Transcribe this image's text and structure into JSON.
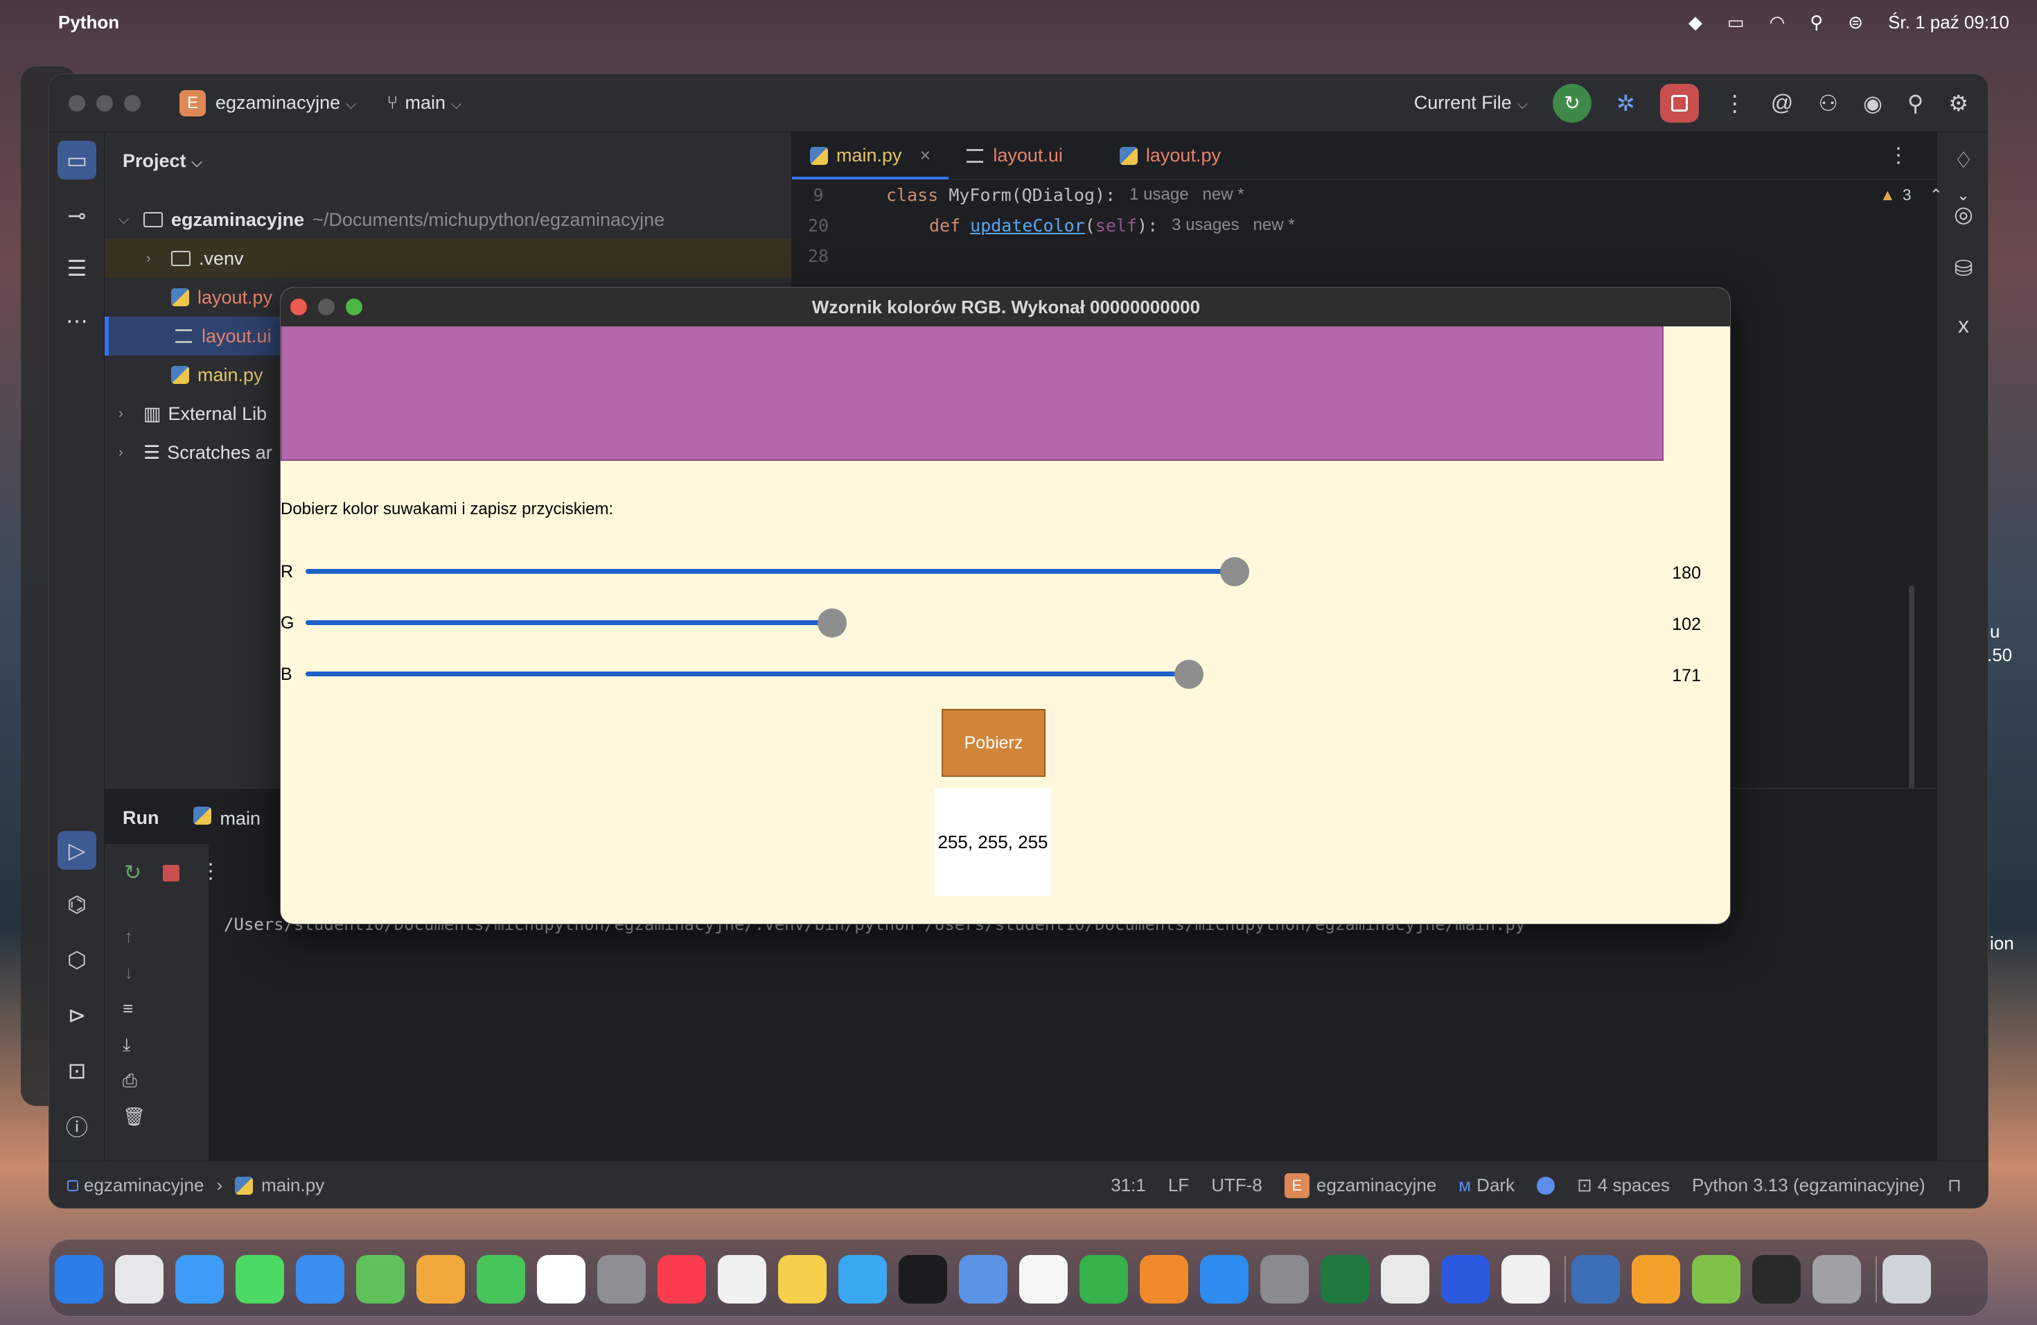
{
  "menubar": {
    "app_name": "Python",
    "datetime": "Śr. 1 paź 09:10"
  },
  "ide": {
    "project_name": "egzaminacyjne",
    "project_badge": "E",
    "branch": "main",
    "run_config": "Current File",
    "project_panel": {
      "title": "Project",
      "root": "egzaminacyjne",
      "root_path": "~/Documents/michupython/egzaminacyjne",
      "items": [
        {
          "label": ".venv"
        },
        {
          "label": "layout.py"
        },
        {
          "label": "layout.ui"
        },
        {
          "label": "main.py"
        },
        {
          "label": "External Lib"
        },
        {
          "label": "Scratches ar"
        }
      ]
    },
    "tabs": [
      {
        "label": "main.py"
      },
      {
        "label": "layout.ui"
      },
      {
        "label": "layout.py"
      }
    ],
    "editor": {
      "warnings": "3",
      "lines": [
        {
          "num": "9",
          "kw": "class",
          "name": " MyForm(QDialog):",
          "hint1": "1 usage",
          "hint2": "new *"
        },
        {
          "num": "20",
          "kw": "def",
          "name": "updateColor",
          "params_open": "(",
          "self": "self",
          "params_close": "):",
          "hint1": "3 usages",
          "hint2": "new *"
        },
        {
          "num": "28"
        }
      ]
    },
    "run": {
      "title": "Run",
      "config": "main",
      "command": "/Users/student10/Documents/michupython/egzaminacyjne/.venv/bin/python /Users/student10/Documents/michupython/egzaminacyjne/main.py"
    },
    "status": {
      "crumb_project": "egzaminacyjne",
      "crumb_file": "main.py",
      "position": "31:1",
      "line_sep": "LF",
      "encoding": "UTF-8",
      "project_badge": "E",
      "project": "egzaminacyjne",
      "theme": "Dark",
      "indent": "4 spaces",
      "interpreter": "Python 3.13 (egzaminacyjne)"
    }
  },
  "dialog": {
    "title": "Wzornik kolorów RGB. Wykonał 00000000000",
    "swatch_color": "#b466ab",
    "instruction": "Dobierz kolor suwakami i zapisz przyciskiem:",
    "sliders": [
      {
        "label": "R",
        "value": "180",
        "fraction": 0.706
      },
      {
        "label": "G",
        "value": "102",
        "fraction": 0.4
      },
      {
        "label": "B",
        "value": "171",
        "fraction": 0.671
      }
    ],
    "button_label": "Pobierz",
    "result": "255, 255, 255"
  },
  "edge_texts": [
    "u",
    ".50",
    "ion"
  ],
  "colors": {
    "accent": "#3574f0",
    "run_green": "#3f8a4a",
    "stop_red": "#c94f4f",
    "button_orange": "#d08539",
    "slider_blue": "#1e5fc8",
    "dialog_bg": "#fff8dc"
  }
}
